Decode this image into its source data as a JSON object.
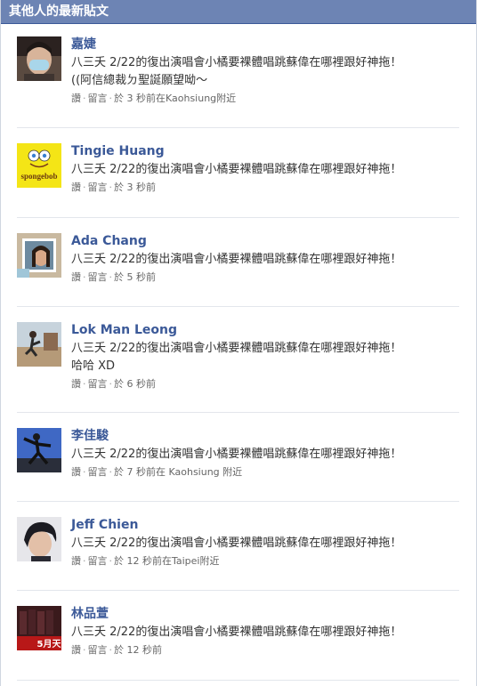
{
  "header": {
    "title": "其他人的最新貼文"
  },
  "actions": {
    "like": "讚",
    "comment": "留言",
    "sep": "·"
  },
  "posts": [
    {
      "name": "嘉婕",
      "lines": [
        "八三夭 2/22的復出演唱會小橘要裸體唱跳蘇偉在哪裡跟好神拖！",
        "((阿信總裁ㄉ聖誕願望呦～"
      ],
      "time": "於 3 秒前在Kaohsiung附近",
      "avatar": "avatar-mask-photo"
    },
    {
      "name": "Tingie Huang",
      "lines": [
        "八三夭 2/22的復出演唱會小橘要裸體唱跳蘇偉在哪裡跟好神拖！"
      ],
      "time": "於 3 秒前",
      "avatar": "avatar-spongebob",
      "avatar_text": "spongebob"
    },
    {
      "name": "Ada Chang",
      "lines": [
        "八三夭 2/22的復出演唱會小橘要裸體唱跳蘇偉在哪裡跟好神拖！"
      ],
      "time": "於 5 秒前",
      "avatar": "avatar-frame-photo"
    },
    {
      "name": "Lok Man Leong",
      "lines": [
        "八三夭 2/22的復出演唱會小橘要裸體唱跳蘇偉在哪裡跟好神拖！",
        "哈哈 XD"
      ],
      "time": "於 6 秒前",
      "avatar": "avatar-jump-photo"
    },
    {
      "name": "李佳駿",
      "lines": [
        "八三夭 2/22的復出演唱會小橘要裸體唱跳蘇偉在哪裡跟好神拖！"
      ],
      "time": "於 7 秒前在 Kaohsiung 附近",
      "avatar": "avatar-martial-photo"
    },
    {
      "name": "Jeff Chien",
      "lines": [
        "八三夭 2/22的復出演唱會小橘要裸體唱跳蘇偉在哪裡跟好神拖！"
      ],
      "time": "於 12 秒前在Taipei附近",
      "avatar": "avatar-portrait-photo"
    },
    {
      "name": "林品萱",
      "lines": [
        "八三夭 2/22的復出演唱會小橘要裸體唱跳蘇偉在哪裡跟好神拖！"
      ],
      "time": "於 12 秒前",
      "avatar": "avatar-band-poster",
      "avatar_text": "5月天"
    }
  ]
}
